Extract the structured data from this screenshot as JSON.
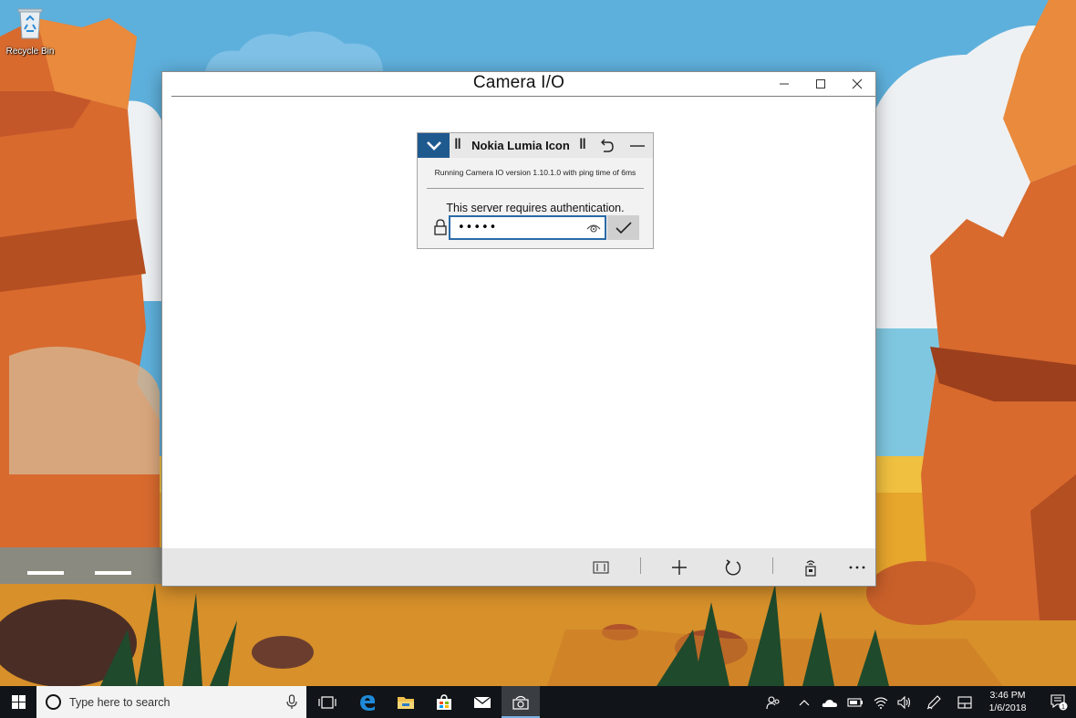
{
  "desktop": {
    "icons": [
      {
        "label": "Recycle Bin",
        "icon": "recycle-bin-icon"
      }
    ]
  },
  "window": {
    "title": "Camera I/O",
    "controls": [
      "minimize-icon",
      "maximize-icon",
      "close-icon"
    ]
  },
  "card": {
    "device_name": "Nokia Lumia Icon",
    "status": "Running Camera IO version 1.10.1.0 with ping time of 6ms",
    "auth_message": "This server requires authentication.",
    "password_value": "•••••",
    "colors": {
      "accent": "#1f5a8f",
      "focus_border": "#2a6aa8"
    }
  },
  "appbar": {
    "buttons": [
      "fit-view-icon",
      "add-icon",
      "refresh-icon",
      "remote-icon",
      "more-icon"
    ]
  },
  "taskbar": {
    "search_placeholder": "Type here to search",
    "pinned": [
      "task-view-icon",
      "edge-icon",
      "file-explorer-icon",
      "store-icon",
      "mail-icon",
      "camera-io-icon"
    ],
    "tray": [
      "people-icon",
      "chevron-up-icon",
      "onedrive-icon",
      "battery-icon",
      "wifi-icon",
      "volume-icon",
      "pen-icon",
      "tablet-mode-icon"
    ],
    "time": "3:46 PM",
    "date": "1/6/2018",
    "notification_count": "1"
  }
}
